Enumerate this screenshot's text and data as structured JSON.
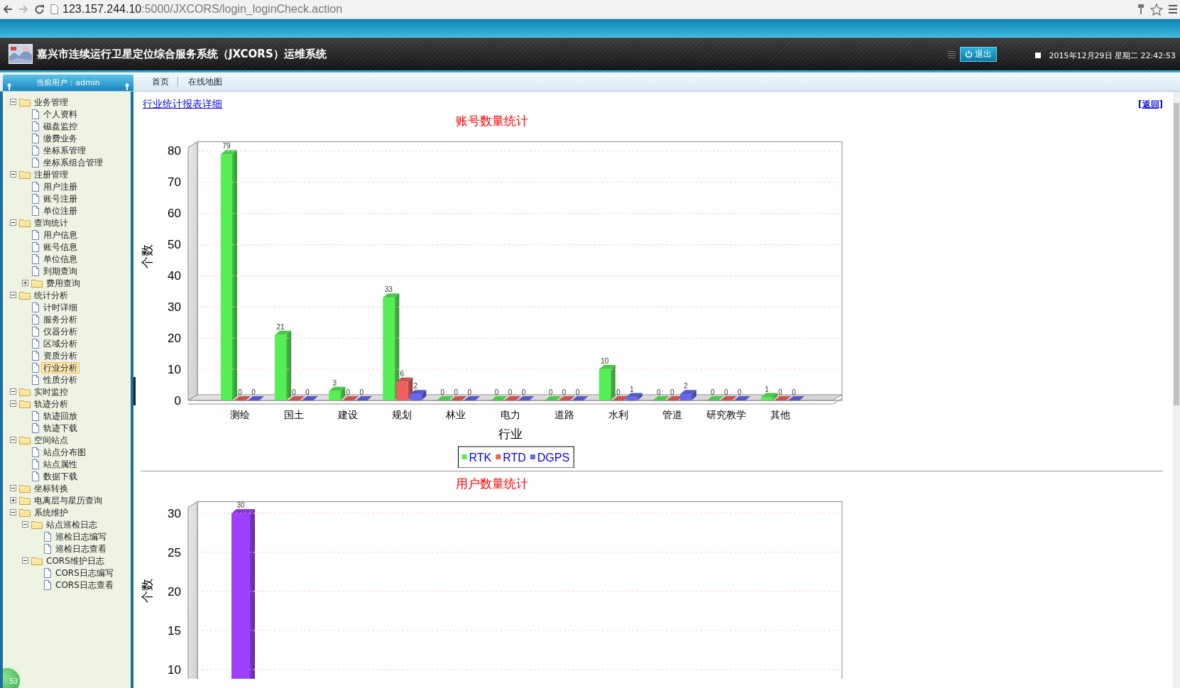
{
  "browser": {
    "url_host": "123.157.244.10",
    "url_path": ":5000/JXCORS/login_loginCheck.action"
  },
  "header": {
    "title": "嘉兴市连续运行卫星定位综合服务系统（JXCORS）运维系统",
    "logout": "退出",
    "datetime": "2015年12月29日 星期二 22:42:53"
  },
  "user_panel": {
    "label": "当前用户：admin"
  },
  "tabs": [
    {
      "label": "首页",
      "selected": false
    },
    {
      "label": "在线地图",
      "selected": false
    }
  ],
  "sidebar": {
    "tree": [
      {
        "label": "业务管理",
        "kind": "folder",
        "expanded": true,
        "selected": false,
        "children": [
          {
            "label": "个人资料",
            "kind": "page",
            "selected": false
          },
          {
            "label": "磁盘监控",
            "kind": "page",
            "selected": false
          },
          {
            "label": "缴费业务",
            "kind": "page",
            "selected": false
          },
          {
            "label": "坐标系管理",
            "kind": "page",
            "selected": false
          },
          {
            "label": "坐标系组合管理",
            "kind": "page",
            "selected": false
          }
        ]
      },
      {
        "label": "注册管理",
        "kind": "folder",
        "expanded": true,
        "selected": false,
        "children": [
          {
            "label": "用户注册",
            "kind": "page",
            "selected": false
          },
          {
            "label": "账号注册",
            "kind": "page",
            "selected": false
          },
          {
            "label": "单位注册",
            "kind": "page",
            "selected": false
          }
        ]
      },
      {
        "label": "查询统计",
        "kind": "folder",
        "expanded": true,
        "selected": false,
        "children": [
          {
            "label": "用户信息",
            "kind": "page",
            "selected": false
          },
          {
            "label": "账号信息",
            "kind": "page",
            "selected": false
          },
          {
            "label": "单位信息",
            "kind": "page",
            "selected": false
          },
          {
            "label": "到期查询",
            "kind": "page",
            "selected": false
          },
          {
            "label": "费用查询",
            "kind": "folder",
            "expanded": false,
            "selected": false
          }
        ]
      },
      {
        "label": "统计分析",
        "kind": "folder",
        "expanded": true,
        "selected": false,
        "children": [
          {
            "label": "计时详细",
            "kind": "page",
            "selected": false
          },
          {
            "label": "服务分析",
            "kind": "page",
            "selected": false
          },
          {
            "label": "仪器分析",
            "kind": "page",
            "selected": false
          },
          {
            "label": "区域分析",
            "kind": "page",
            "selected": false
          },
          {
            "label": "资质分析",
            "kind": "page",
            "selected": false
          },
          {
            "label": "行业分析",
            "kind": "page",
            "selected": true
          },
          {
            "label": "性质分析",
            "kind": "page",
            "selected": false
          }
        ]
      },
      {
        "label": "实时监控",
        "kind": "folder",
        "expanded": true,
        "selected": false
      },
      {
        "label": "轨迹分析",
        "kind": "folder",
        "expanded": true,
        "selected": false,
        "children": [
          {
            "label": "轨迹回放",
            "kind": "page",
            "selected": false
          },
          {
            "label": "轨迹下载",
            "kind": "page",
            "selected": false
          }
        ]
      },
      {
        "label": "空间站点",
        "kind": "folder",
        "expanded": true,
        "selected": false,
        "children": [
          {
            "label": "站点分布图",
            "kind": "page",
            "selected": false
          },
          {
            "label": "站点属性",
            "kind": "page",
            "selected": false
          },
          {
            "label": "数据下载",
            "kind": "page",
            "selected": false
          }
        ]
      },
      {
        "label": "坐标转换",
        "kind": "folder",
        "expanded": true,
        "selected": false
      },
      {
        "label": "电离层与星历查询",
        "kind": "folder",
        "expanded": false,
        "selected": false
      },
      {
        "label": "系统维护",
        "kind": "folder",
        "expanded": true,
        "selected": false,
        "children": [
          {
            "label": "站点巡检日志",
            "kind": "folder",
            "expanded": true,
            "selected": false,
            "children": [
              {
                "label": "巡检日志编写",
                "kind": "page",
                "selected": false
              },
              {
                "label": "巡检日志查看",
                "kind": "page",
                "selected": false
              }
            ]
          },
          {
            "label": "CORS维护日志",
            "kind": "folder",
            "expanded": true,
            "selected": false,
            "children": [
              {
                "label": "CORS日志编写",
                "kind": "page",
                "selected": false
              },
              {
                "label": "CORS日志查看",
                "kind": "page",
                "selected": false
              }
            ]
          }
        ]
      }
    ]
  },
  "content": {
    "detail_link": "行业统计报表详细",
    "back_link": "[返回]",
    "charts": [
      {
        "chart_data": {
          "type": "bar",
          "title": "账号数量统计",
          "xlabel": "行业",
          "ylabel": "个数",
          "categories": [
            "测绘",
            "国土",
            "建设",
            "规划",
            "林业",
            "电力",
            "道路",
            "水利",
            "管道",
            "研究教学",
            "其他"
          ],
          "ylim": [
            0,
            83
          ],
          "yticks": [
            0,
            10,
            20,
            30,
            40,
            50,
            60,
            70,
            80
          ],
          "grid": true,
          "legend": true,
          "data_labels": true,
          "series": [
            {
              "name": "RTK",
              "color": "#55ee55",
              "values": [
                79,
                21,
                3,
                33,
                0,
                0,
                0,
                10,
                0,
                0,
                1
              ]
            },
            {
              "name": "RTD",
              "color": "#f06060",
              "values": [
                0,
                0,
                0,
                6,
                0,
                0,
                0,
                0,
                0,
                0,
                0
              ]
            },
            {
              "name": "DGPS",
              "color": "#6666ee",
              "values": [
                0,
                0,
                0,
                2,
                0,
                0,
                0,
                1,
                2,
                0,
                0
              ]
            }
          ]
        }
      },
      {
        "chart_data": {
          "type": "bar",
          "title": "用户数量统计",
          "ylabel": "个数",
          "ylim": [
            0,
            31.5
          ],
          "yticks": [
            10,
            15,
            20,
            25,
            30
          ],
          "grid": true,
          "data_labels": true,
          "series": [
            {
              "color": "#a040ff",
              "values": [
                30
              ]
            }
          ]
        }
      }
    ]
  },
  "badge": {
    "text": "53"
  }
}
